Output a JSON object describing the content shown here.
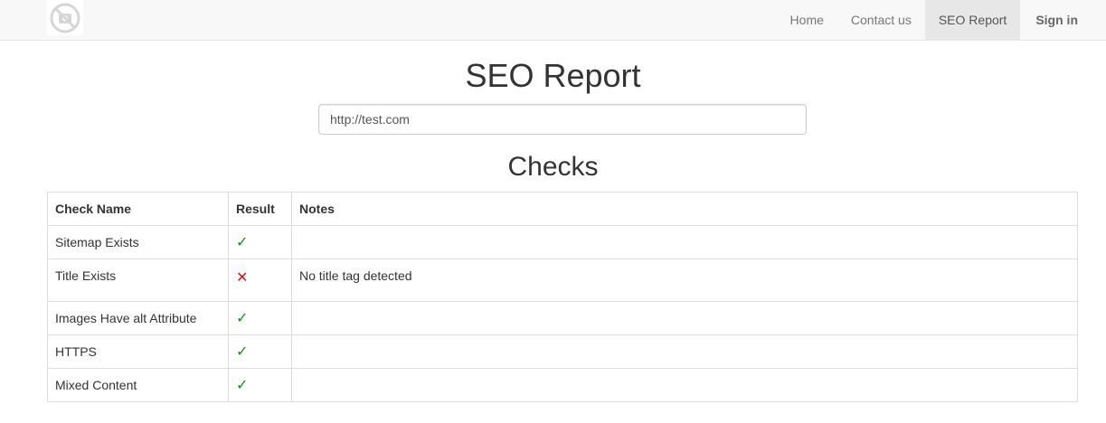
{
  "navbar": {
    "logo_icon": "broken-image-icon",
    "links": [
      {
        "label": "Home",
        "active": false
      },
      {
        "label": "Contact us",
        "active": false
      },
      {
        "label": "SEO Report",
        "active": true
      }
    ],
    "signin_label": "Sign in"
  },
  "main": {
    "title": "SEO Report",
    "url_value": "http://test.com",
    "checks_title": "Checks",
    "table": {
      "headers": [
        "Check Name",
        "Result",
        "Notes"
      ],
      "rows": [
        {
          "name": "Sitemap Exists",
          "result": "✓",
          "status": "pass",
          "notes": ""
        },
        {
          "name": "Title Exists",
          "result": "✕",
          "status": "fail",
          "notes": "No title tag detected"
        },
        {
          "name": "Images Have alt Attribute",
          "result": "✓",
          "status": "pass",
          "notes": ""
        },
        {
          "name": "HTTPS",
          "result": "✓",
          "status": "pass",
          "notes": ""
        },
        {
          "name": "Mixed Content",
          "result": "✓",
          "status": "pass",
          "notes": ""
        }
      ]
    }
  },
  "colors": {
    "pass": "#1a8a1a",
    "fail": "#dd1111",
    "navbar_bg": "#f8f8f8",
    "active_link_bg": "#e7e7e7"
  }
}
